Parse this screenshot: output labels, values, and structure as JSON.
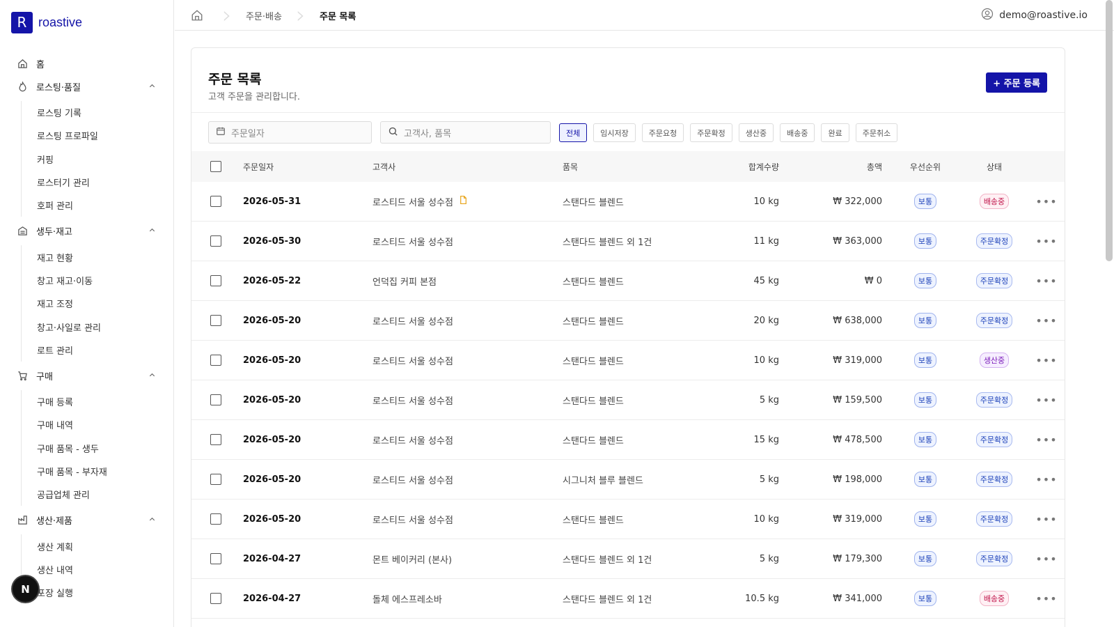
{
  "brand": {
    "logo_letter": "R",
    "name": "roastive"
  },
  "sidebar": {
    "sections": [
      {
        "label": "홈",
        "icon": "home-icon",
        "items": []
      },
      {
        "label": "로스팅·품질",
        "icon": "flame-icon",
        "items": [
          "로스팅 기록",
          "로스팅 프로파일",
          "커핑",
          "로스터기 관리",
          "호퍼 관리"
        ]
      },
      {
        "label": "생두·재고",
        "icon": "warehouse-icon",
        "items": [
          "재고 현황",
          "창고 재고·이동",
          "재고 조정",
          "창고·사일로 관리",
          "로트 관리"
        ]
      },
      {
        "label": "구매",
        "icon": "cart-icon",
        "items": [
          "구매 등록",
          "구매 내역",
          "구매 품목 - 생두",
          "구매 품목 - 부자재",
          "공급업체 관리"
        ]
      },
      {
        "label": "생산·제품",
        "icon": "factory-icon",
        "items": [
          "생산 계획",
          "생산 내역",
          "포장 실행"
        ]
      }
    ]
  },
  "floating": {
    "letter": "N"
  },
  "breadcrumb": {
    "items": [
      "주문·배송",
      "주문 목록"
    ]
  },
  "user": {
    "email": "demo@roastive.io"
  },
  "page": {
    "title": "주문 목록",
    "subtitle": "고객 주문을 관리합니다.",
    "add_button": "+ 주문 등록"
  },
  "filters": {
    "date_placeholder": "주문일자",
    "search_placeholder": "고객사, 품목",
    "chips": [
      "전체",
      "임시저장",
      "주문요청",
      "주문확정",
      "생산중",
      "배송중",
      "완료",
      "주문취소"
    ],
    "active_chip": "전체"
  },
  "table": {
    "headers": {
      "date": "주문일자",
      "customer": "고객사",
      "item": "품목",
      "qty": "합계수량",
      "total": "총액",
      "priority": "우선순위",
      "status": "상태"
    },
    "rows": [
      {
        "date": "2026-05-31",
        "customer": "로스티드 서울 성수점",
        "memo": true,
        "item": "스탠다드 블렌드",
        "qty": "10 kg",
        "total": "₩ 322,000",
        "priority": "보통",
        "status": "배송중",
        "status_color": "red"
      },
      {
        "date": "2026-05-30",
        "customer": "로스티드 서울 성수점",
        "memo": false,
        "item": "스탠다드 블렌드 외 1건",
        "qty": "11 kg",
        "total": "₩ 363,000",
        "priority": "보통",
        "status": "주문확정",
        "status_color": "blue"
      },
      {
        "date": "2026-05-22",
        "customer": "언덕집 커피 본점",
        "memo": false,
        "item": "스탠다드 블렌드",
        "qty": "45 kg",
        "total": "₩ 0",
        "priority": "보통",
        "status": "주문확정",
        "status_color": "blue"
      },
      {
        "date": "2026-05-20",
        "customer": "로스티드 서울 성수점",
        "memo": false,
        "item": "스탠다드 블렌드",
        "qty": "20 kg",
        "total": "₩ 638,000",
        "priority": "보통",
        "status": "주문확정",
        "status_color": "blue"
      },
      {
        "date": "2026-05-20",
        "customer": "로스티드 서울 성수점",
        "memo": false,
        "item": "스탠다드 블렌드",
        "qty": "10 kg",
        "total": "₩ 319,000",
        "priority": "보통",
        "status": "생산중",
        "status_color": "purple"
      },
      {
        "date": "2026-05-20",
        "customer": "로스티드 서울 성수점",
        "memo": false,
        "item": "스탠다드 블렌드",
        "qty": "5 kg",
        "total": "₩ 159,500",
        "priority": "보통",
        "status": "주문확정",
        "status_color": "blue"
      },
      {
        "date": "2026-05-20",
        "customer": "로스티드 서울 성수점",
        "memo": false,
        "item": "스탠다드 블렌드",
        "qty": "15 kg",
        "total": "₩ 478,500",
        "priority": "보통",
        "status": "주문확정",
        "status_color": "blue"
      },
      {
        "date": "2026-05-20",
        "customer": "로스티드 서울 성수점",
        "memo": false,
        "item": "시그니처 블루 블렌드",
        "qty": "5 kg",
        "total": "₩ 198,000",
        "priority": "보통",
        "status": "주문확정",
        "status_color": "blue"
      },
      {
        "date": "2026-05-20",
        "customer": "로스티드 서울 성수점",
        "memo": false,
        "item": "스탠다드 블렌드",
        "qty": "10 kg",
        "total": "₩ 319,000",
        "priority": "보통",
        "status": "주문확정",
        "status_color": "blue"
      },
      {
        "date": "2026-04-27",
        "customer": "몬트 베이커리 (본사)",
        "memo": false,
        "item": "스탠다드 블렌드 외 1건",
        "qty": "5 kg",
        "total": "₩ 179,300",
        "priority": "보통",
        "status": "주문확정",
        "status_color": "blue"
      },
      {
        "date": "2026-04-27",
        "customer": "돌체 에스프레소바",
        "memo": false,
        "item": "스탠다드 블렌드 외 1건",
        "qty": "10.5 kg",
        "total": "₩ 341,000",
        "priority": "보통",
        "status": "배송중",
        "status_color": "red"
      }
    ]
  },
  "colors": {
    "accent": "#1414a8",
    "status_blue": "#1a3fb8",
    "status_red": "#c0144a",
    "status_purple": "#7a1ab8"
  }
}
